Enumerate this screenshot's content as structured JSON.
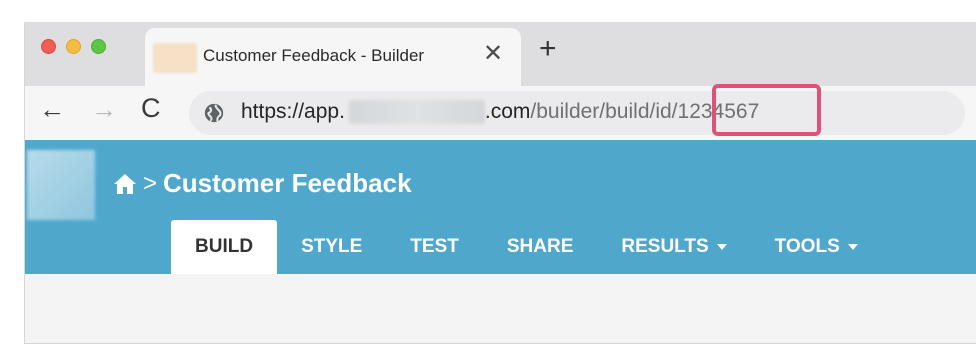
{
  "browser": {
    "tab": {
      "title": "Customer Feedback - Builder",
      "close_glyph": "✕"
    },
    "new_tab_glyph": "+",
    "nav": {
      "back_glyph": "←",
      "forward_glyph": "→",
      "reload_glyph": "C"
    },
    "address": {
      "prefix": "https://app.",
      "domain_suffix": ".com",
      "path": "/builder/build/id/",
      "id": "1234567"
    },
    "highlight_color": "#e05077"
  },
  "app": {
    "title": "Customer Feedback",
    "breadcrumb_separator": ">",
    "header_color": "#4fa8cc",
    "tabs": [
      {
        "label": "BUILD",
        "active": true
      },
      {
        "label": "STYLE",
        "active": false
      },
      {
        "label": "TEST",
        "active": false
      },
      {
        "label": "SHARE",
        "active": false
      },
      {
        "label": "RESULTS",
        "active": false,
        "dropdown": true
      },
      {
        "label": "TOOLS",
        "active": false,
        "dropdown": true
      }
    ]
  }
}
